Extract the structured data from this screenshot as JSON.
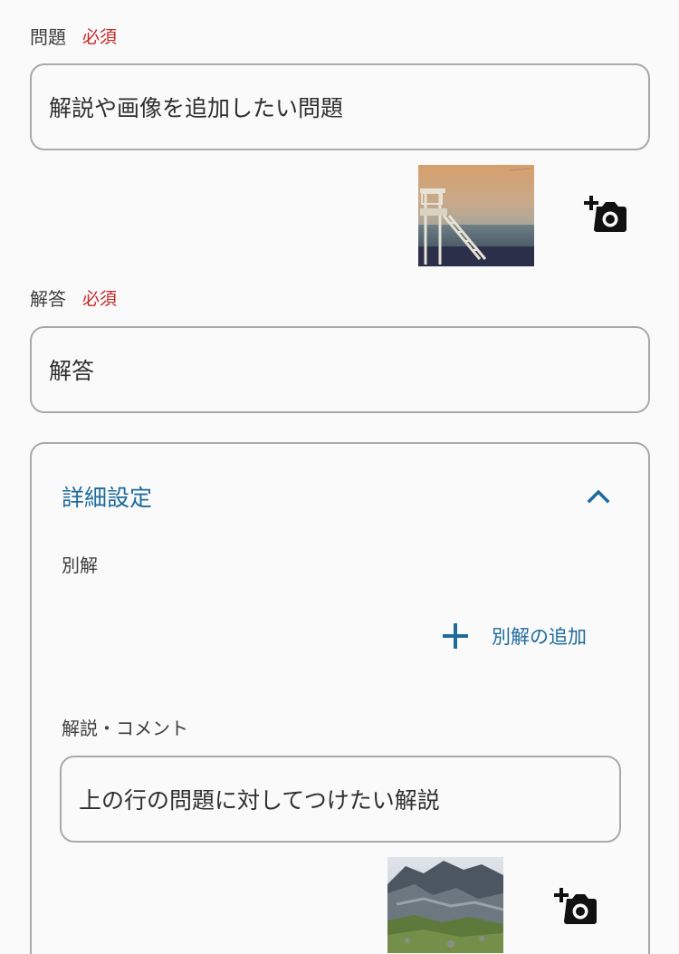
{
  "question": {
    "label": "問題",
    "required": "必須",
    "value": "解説や画像を追加したい問題"
  },
  "answer": {
    "label": "解答",
    "required": "必須",
    "value": "解答"
  },
  "details": {
    "title": "詳細設定",
    "alt_answers_label": "別解",
    "add_alt_answer_label": "別解の追加",
    "comment_label": "解説・コメント",
    "comment_value": "上の行の問題に対してつけたい解説"
  },
  "colors": {
    "accent": "#1f6b9c",
    "required": "#c62828",
    "border": "#a9a9a9"
  },
  "icons": {
    "add_photo": "add-photo-camera-icon",
    "collapse": "chevron-up-icon",
    "add": "plus-icon"
  }
}
